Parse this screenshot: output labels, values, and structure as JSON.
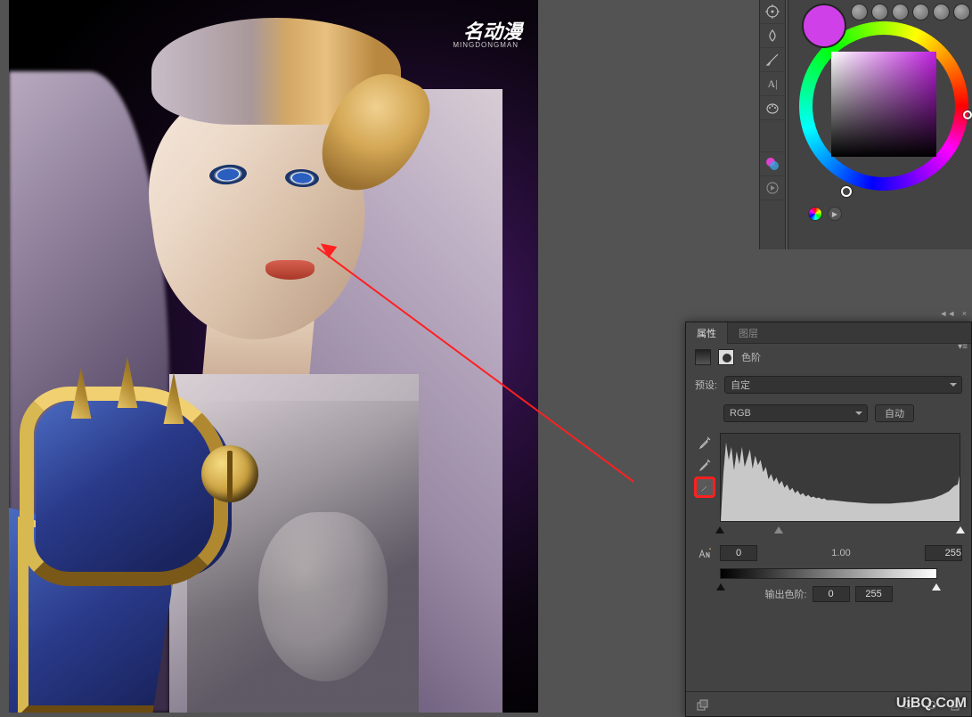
{
  "logo": {
    "text": "名动漫",
    "sub": "MINGDONGMAN"
  },
  "watermark": "UiBQ.CoM",
  "toolbar": {
    "tools": [
      "target",
      "blur",
      "brush",
      "text",
      "palette",
      "bucket",
      "layers"
    ]
  },
  "properties": {
    "tab_active": "属性",
    "tab_inactive": "图层",
    "adj_label": "色阶",
    "preset_label": "预设:",
    "preset_value": "自定",
    "channel_value": "RGB",
    "auto_label": "自动",
    "input_black": "0",
    "input_gamma": "1.00",
    "input_white": "255",
    "output_label": "输出色阶:",
    "output_black": "0",
    "output_white": "255"
  }
}
